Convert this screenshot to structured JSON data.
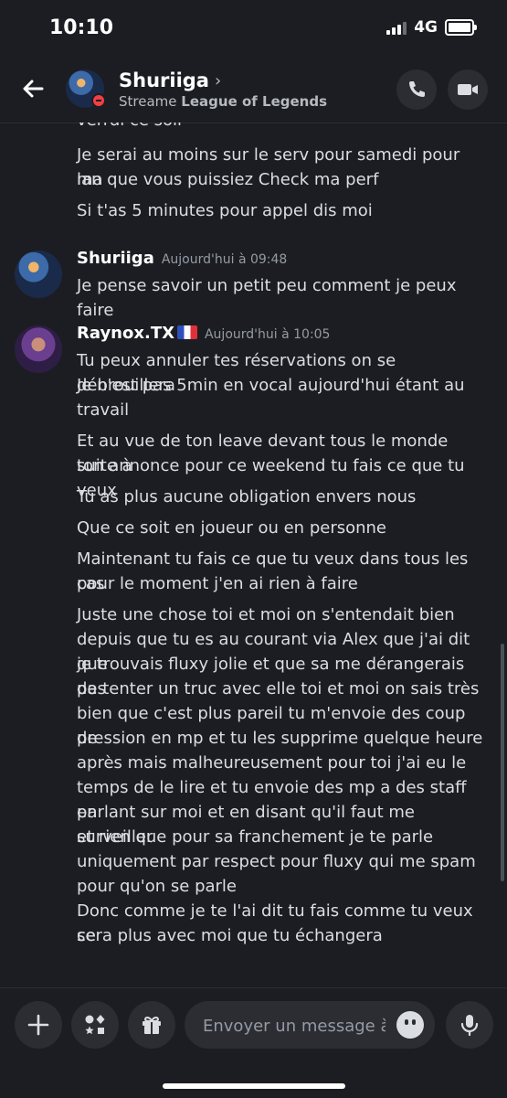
{
  "status_bar": {
    "time": "10:10",
    "network": "4G"
  },
  "header": {
    "name": "Shuriiga",
    "status_prefix": "Streame",
    "status_game": "League of Legends"
  },
  "messages": {
    "cut_line": "verrai ce soir",
    "continuation": [
      "Je serai au moins sur le serv pour samedi pour ma",
      "lan que vous puissiez Check ma perf",
      "Si t'as 5 minutes pour appel dis moi"
    ],
    "group1": {
      "author": "Shuriiga",
      "time": "Aujourd'hui à 09:48",
      "lines": [
        "Je pense savoir un petit peu comment je peux faire"
      ]
    },
    "group2": {
      "author": "Raynox.TX",
      "time": "Aujourd'hui à 10:05",
      "lines": [
        "Tu peux annuler tes réservations on se débrouillera",
        "Je n'est pas 5min en vocal aujourd'hui étant au",
        "travail",
        "Et au vue de ton leave devant tous le monde suite à",
        "ton annonce pour ce weekend tu fais ce que tu veux",
        "Tu as plus aucune obligation envers nous",
        "Que ce soit en joueur ou en personne",
        "Maintenant tu fais ce que tu veux dans tous les cas",
        "pour le moment j'en ai rien à faire",
        "Juste une chose toi et moi on s'entendait bien",
        "depuis que tu es au courant via Alex que j'ai dit que",
        "je trouvais fluxy jolie et que sa me dérangerais pas",
        "de tenter un truc avec elle toi et moi on sais très",
        "bien que c'est plus pareil tu m'envoie des coup de",
        "pression en mp et tu les supprime quelque heure",
        "après mais malheureusement pour toi j'ai eu le",
        "temps de le lire et tu envoie des mp a des staff en",
        "parlant sur moi et en disant qu'il faut me surveiller",
        "et rien que pour sa franchement je te parle",
        "uniquement par respect pour fluxy qui me spam",
        "pour qu'on se parle",
        "Donc comme je te l'ai dit tu fais comme tu veux ce",
        "sera plus avec moi que tu échangera"
      ]
    }
  },
  "composer": {
    "placeholder": "Envoyer un message à..."
  },
  "colors": {
    "background": "#1c1d22",
    "dnd": "#f23f43",
    "muted": "#949ba4"
  }
}
